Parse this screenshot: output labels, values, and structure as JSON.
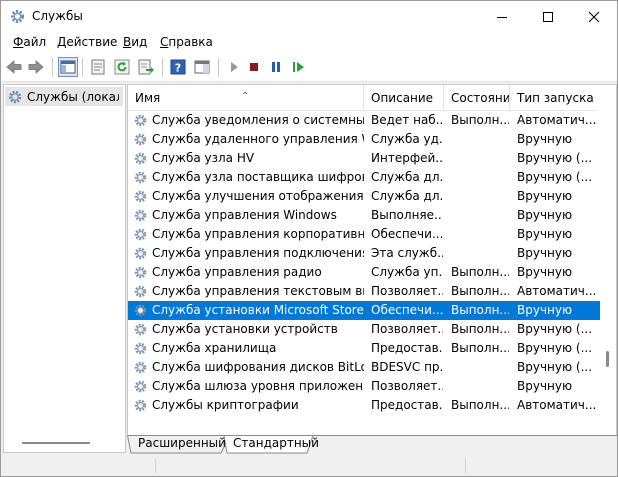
{
  "window": {
    "title": "Службы"
  },
  "menu": [
    {
      "label": "Файл",
      "accel": "Ф"
    },
    {
      "label": "Действие",
      "accel": "Д"
    },
    {
      "label": "Вид",
      "accel": "В"
    },
    {
      "label": "Справка",
      "accel": "С"
    }
  ],
  "toolbar": [
    "back-arrow-icon",
    "forward-arrow-icon",
    "show-hide-tree-icon",
    "properties-icon",
    "refresh-icon",
    "export-list-icon",
    "help-icon",
    "show-action-pane-icon",
    "start-service-icon",
    "stop-service-icon",
    "pause-service-icon",
    "resume-service-icon"
  ],
  "tree": {
    "item": "Службы (локальные)"
  },
  "columns": {
    "name": "Имя",
    "desc": "Описание",
    "status": "Состояние",
    "startup": "Тип запуска"
  },
  "services": [
    {
      "name": "Служба уведомления о системных событиях",
      "desc": "Ведет наблюдение",
      "status": "Выполняется",
      "startup": "Автоматически"
    },
    {
      "name": "Служба удаленного управления Windows",
      "desc": "Служба удаленного",
      "status": "",
      "startup": "Вручную"
    },
    {
      "name": "Служба узла HV",
      "desc": "Интерфейс",
      "status": "",
      "startup": "Вручную (активировать)"
    },
    {
      "name": "Служба узла поставщика шифрования",
      "desc": "Служба для",
      "status": "",
      "startup": "Вручную (активировать)"
    },
    {
      "name": "Служба улучшения отображения",
      "desc": "Служба для",
      "status": "",
      "startup": "Вручную"
    },
    {
      "name": "Служба управления Windows",
      "desc": "Выполняет",
      "status": "",
      "startup": "Вручную"
    },
    {
      "name": "Служба управления корпоративными",
      "desc": "Обеспечивает",
      "status": "",
      "startup": "Вручную"
    },
    {
      "name": "Служба управления подключениями",
      "desc": "Эта служба",
      "status": "",
      "startup": "Вручную"
    },
    {
      "name": "Служба управления радио",
      "desc": "Служба управления",
      "status": "Выполняется",
      "startup": "Вручную"
    },
    {
      "name": "Служба управления текстовым вводом",
      "desc": "Позволяет",
      "status": "Выполняется",
      "startup": "Автоматически"
    },
    {
      "name": "Служба установки Microsoft Store",
      "desc": "Обеспечивает",
      "status": "Выполняется",
      "startup": "Вручную"
    },
    {
      "name": "Служба установки устройств",
      "desc": "Позволяет",
      "status": "Выполняется",
      "startup": "Вручную (активировать)"
    },
    {
      "name": "Служба хранилища",
      "desc": "Предоставляет",
      "status": "Выполняется",
      "startup": "Вручную (активировать)"
    },
    {
      "name": "Служба шифрования дисков BitLocker",
      "desc": "BDESVC предоставляет",
      "status": "",
      "startup": "Вручную (активировать)"
    },
    {
      "name": "Служба шлюза уровня приложения",
      "desc": "Позволяет",
      "status": "",
      "startup": "Вручную"
    },
    {
      "name": "Службы криптографии",
      "desc": "Предоставляет",
      "status": "Выполняется",
      "startup": "Автоматически"
    }
  ],
  "display": {
    "rows": [
      {
        "name": "Служба уведомления о системных с...",
        "desc": "Ведет наб...",
        "status": "Выполн...",
        "startup": "Автоматич..."
      },
      {
        "name": "Служба удаленного управления Win...",
        "desc": "Служба уд...",
        "status": "",
        "startup": "Вручную"
      },
      {
        "name": "Служба узла HV",
        "desc": "Интерфей...",
        "status": "",
        "startup": "Вручную (..."
      },
      {
        "name": "Служба узла поставщика шифрова...",
        "desc": "Служба дл...",
        "status": "",
        "startup": "Вручную (..."
      },
      {
        "name": "Служба улучшения отображения",
        "desc": "Служба дл...",
        "status": "",
        "startup": "Вручную"
      },
      {
        "name": "Служба управления Windows",
        "desc": "Выполняе...",
        "status": "",
        "startup": "Вручную"
      },
      {
        "name": "Служба управления корпоративны...",
        "desc": "Обеспечи...",
        "status": "",
        "startup": "Вручную"
      },
      {
        "name": "Служба управления подключениям...",
        "desc": "Эта служб...",
        "status": "",
        "startup": "Вручную"
      },
      {
        "name": "Служба управления радио",
        "desc": "Служба уп...",
        "status": "Выполн...",
        "startup": "Вручную"
      },
      {
        "name": "Служба управления текстовым ввод...",
        "desc": "Позволяет...",
        "status": "Выполн...",
        "startup": "Автоматич..."
      },
      {
        "name": "Служба установки Microsoft Store",
        "desc": "Обеспечи...",
        "status": "Выполн...",
        "startup": "Вручную"
      },
      {
        "name": "Служба установки устройств",
        "desc": "Позволяет...",
        "status": "Выполн...",
        "startup": "Вручную (..."
      },
      {
        "name": "Служба хранилища",
        "desc": "Предостав...",
        "status": "Выполн...",
        "startup": "Вручную (..."
      },
      {
        "name": "Служба шифрования дисков BitLock...",
        "desc": "BDESVC пр...",
        "status": "",
        "startup": "Вручную (..."
      },
      {
        "name": "Служба шлюза уровня приложения",
        "desc": "Позволяет...",
        "status": "",
        "startup": "Вручную"
      },
      {
        "name": "Службы криптографии",
        "desc": "Предостав...",
        "status": "Выполн...",
        "startup": "Автоматич..."
      }
    ],
    "selected_index": 10
  },
  "tabs": {
    "extended": "Расширенный",
    "standard": "Стандартный",
    "active": "standard"
  },
  "colors": {
    "selection": "#0078d7",
    "accent_play": "#2e9d3a",
    "accent_stop": "#8b1a1a"
  }
}
